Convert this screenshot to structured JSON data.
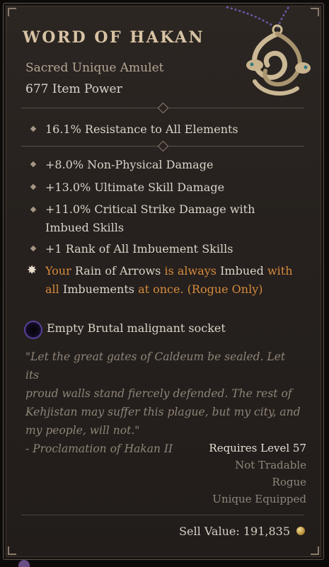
{
  "item": {
    "name": "WORD OF HAKAN",
    "type": "Sacred Unique Amulet",
    "item_power": "677 Item Power"
  },
  "implicit": "16.1% Resistance to All Elements",
  "affixes": [
    {
      "text": "+8.0% Non-Physical Damage"
    },
    {
      "text": "+13.0% Ultimate Skill Damage"
    },
    {
      "text": "+11.0% Critical Strike Damage with Imbued Skills"
    },
    {
      "text": "+1 Rank of All Imbuement Skills"
    }
  ],
  "unique_power": {
    "p1": "Your",
    "p2": "Rain of Arrows",
    "p3": "is always",
    "p4": "Imbued",
    "p5": "with all",
    "p6": "Imbuements",
    "p7": "at once. (Rogue Only)"
  },
  "socket": {
    "text": "Empty Brutal malignant socket",
    "color": "#3f2a82"
  },
  "flavor": [
    "\"Let the great gates of Caldeum be sealed. Let its",
    "proud walls stand fiercely defended. The rest of",
    "Kehjistan may suffer this plague, but my city, and",
    "my people, will not.\"",
    "- Proclamation of Hakan II"
  ],
  "requirements": {
    "level": "Requires Level 57",
    "tradable": "Not Tradable",
    "class": "Rogue",
    "unique_equipped": "Unique Equipped"
  },
  "sell": {
    "label": "Sell Value:",
    "value": "191,835",
    "icon": "gold-coin-icon"
  },
  "colors": {
    "title": "#d7c3a3",
    "unique_text": "#d68a3c",
    "socket_ring": "#574099"
  }
}
